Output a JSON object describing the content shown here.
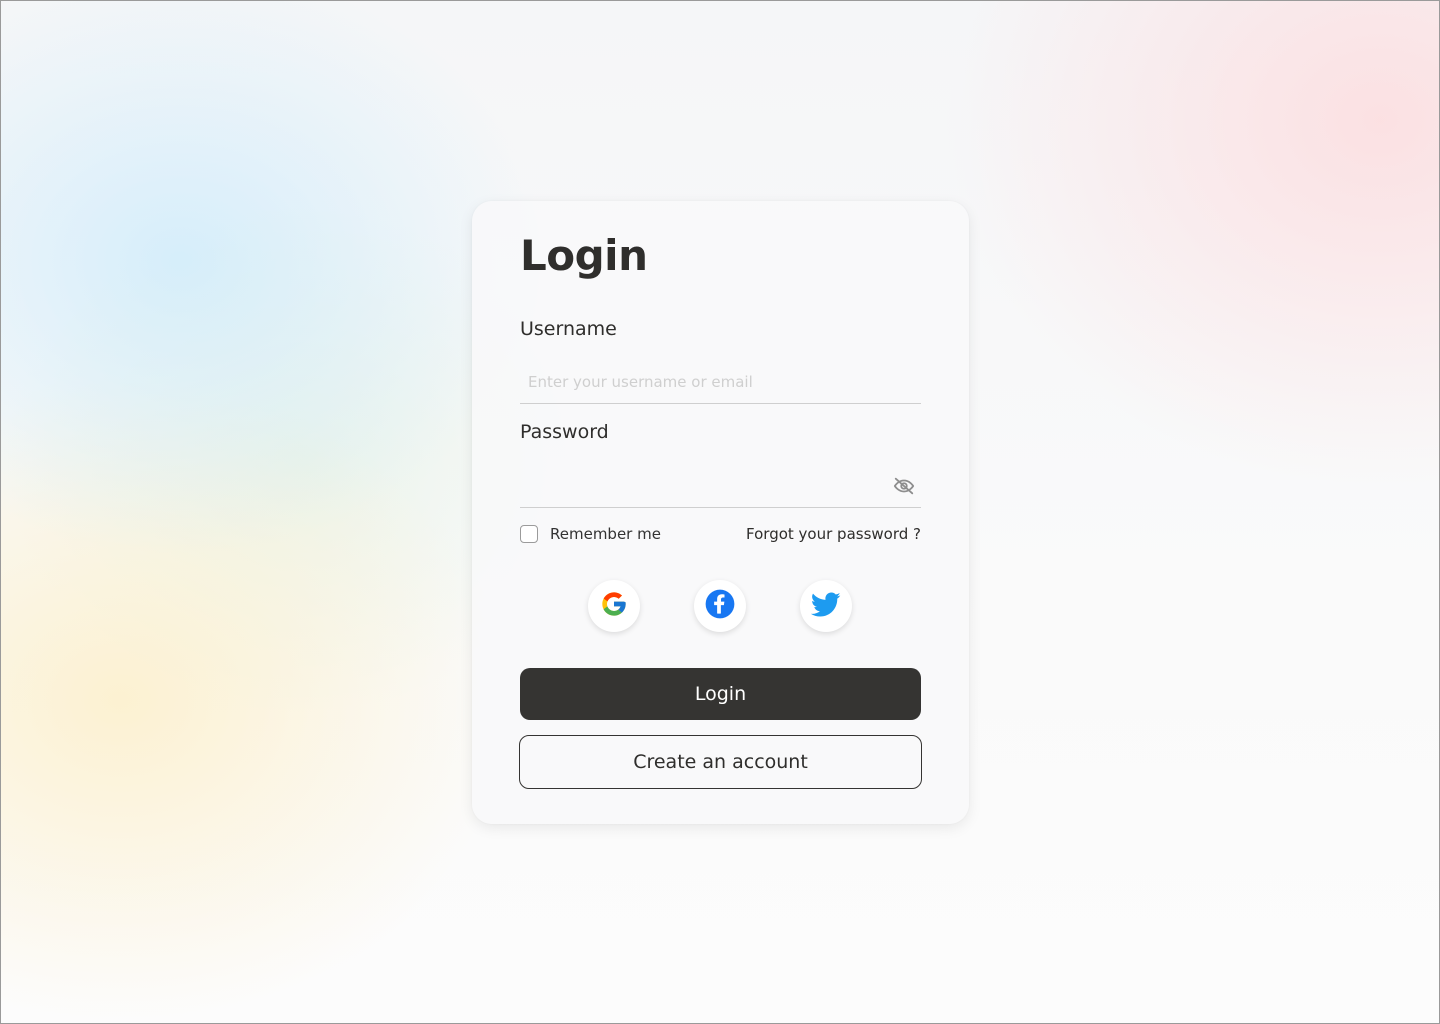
{
  "login": {
    "title": "Login",
    "username_label": "Username",
    "username_placeholder": "Enter your username or email",
    "username_value": "",
    "password_label": "Password",
    "password_value": "",
    "remember_label": "Remember me",
    "remember_checked": false,
    "forgot_label": "Forgot your password ?",
    "login_button": "Login",
    "create_account_button": "Create an account"
  },
  "social": [
    {
      "name": "Google",
      "icon": "google-icon"
    },
    {
      "name": "Facebook",
      "icon": "facebook-icon"
    },
    {
      "name": "Twitter",
      "icon": "twitter-icon"
    }
  ],
  "colors": {
    "primary_button": "#353432",
    "text": "#2f2e2c",
    "facebook": "#1877f2",
    "twitter": "#1d9bf0"
  }
}
